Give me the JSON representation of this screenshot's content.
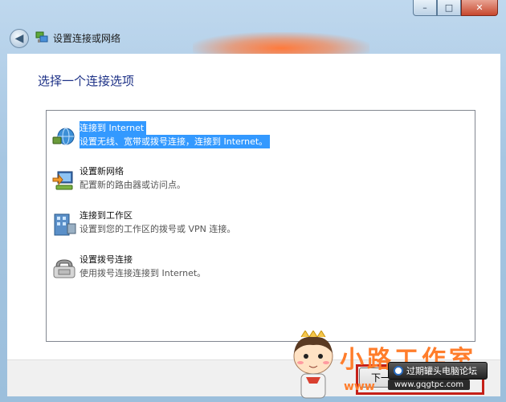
{
  "window": {
    "title": "设置连接或网络",
    "controls": {
      "minimize": "–",
      "maximize": "□",
      "close": "✕"
    }
  },
  "main": {
    "heading": "选择一个连接选项",
    "options": [
      {
        "title": "连接到 Internet",
        "description": "设置无线、宽带或拨号连接，连接到 Internet。",
        "icon": "globe-network-icon",
        "selected": true
      },
      {
        "title": "设置新网络",
        "description": "配置新的路由器或访问点。",
        "icon": "router-network-icon",
        "selected": false
      },
      {
        "title": "连接到工作区",
        "description": "设置到您的工作区的拨号或 VPN 连接。",
        "icon": "workplace-building-icon",
        "selected": false
      },
      {
        "title": "设置拨号连接",
        "description": "使用拨号连接连接到 Internet。",
        "icon": "telephone-modem-icon",
        "selected": false
      }
    ]
  },
  "footer": {
    "next_label": "下一"
  },
  "watermark": {
    "title": "小路工作室",
    "www": "www",
    "forum": "过期罐头电脑论坛",
    "url": "www.gqgtpc.com"
  },
  "colors": {
    "heading": "#1e3287",
    "selection": "#3399ff",
    "highlight_box": "#c52018",
    "watermark": "#ff7d2b"
  }
}
